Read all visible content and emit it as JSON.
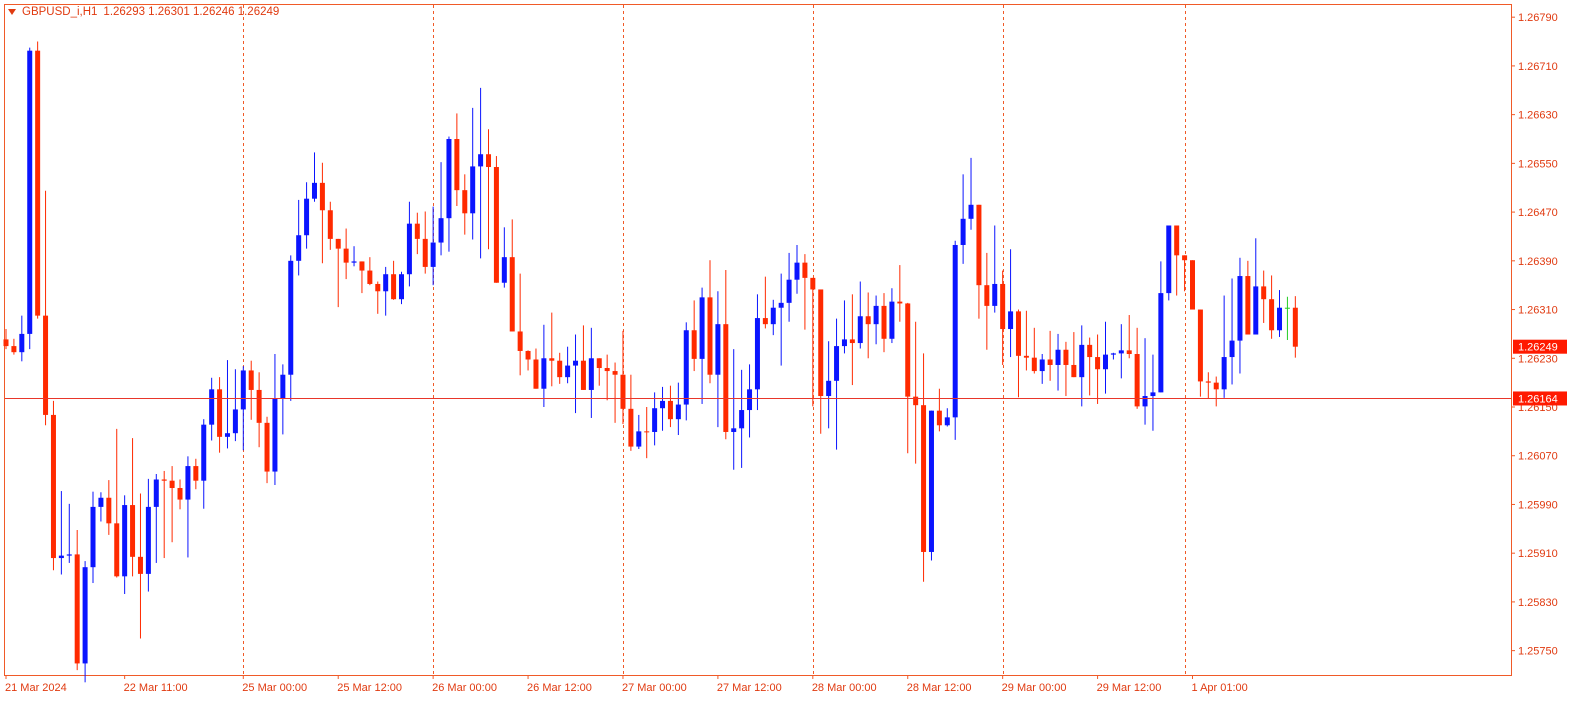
{
  "header": {
    "symbol": "GBPUSD_i,H1",
    "ohlc": "1.26293 1.26301 1.26246 1.26249"
  },
  "colors": {
    "frame": "#f05a28",
    "bull": "#0a14ff",
    "bear": "#ff2a00",
    "doji": "#22cc22",
    "separator": "#f05a28",
    "price_line": "#e8362a",
    "price_tag_bg": "#ff1a00",
    "price_tag_text": "#ffffff",
    "axis_text": "#e03a10"
  },
  "chart_data": {
    "type": "candlestick",
    "ylim": [
      1.2571,
      1.2681
    ],
    "y_ticks": [
      "1.26790",
      "1.26710",
      "1.26630",
      "1.26550",
      "1.26470",
      "1.26390",
      "1.26310",
      "1.26230",
      "1.26150",
      "1.26070",
      "1.25990",
      "1.25910",
      "1.25830",
      "1.25750"
    ],
    "x_labels": [
      "21 Mar 2024",
      "22 Mar 11:00",
      "25 Mar 00:00",
      "25 Mar 12:00",
      "26 Mar 00:00",
      "26 Mar 12:00",
      "27 Mar 00:00",
      "27 Mar 12:00",
      "28 Mar 00:00",
      "28 Mar 12:00",
      "29 Mar 00:00",
      "29 Mar 12:00",
      "1 Apr 01:00"
    ],
    "x_label_bar_index": [
      0,
      15,
      30,
      42,
      54,
      66,
      78,
      90,
      102,
      114,
      126,
      138,
      150
    ],
    "day_separator_bar_index": [
      30,
      54,
      78,
      102,
      126,
      149
    ],
    "last_price": "1.26249",
    "marked_price": "1.26164",
    "candles": [
      [
        1.26261,
        1.26278,
        1.26245,
        1.2625
      ],
      [
        1.2625,
        1.26262,
        1.26236,
        1.2624
      ],
      [
        1.2624,
        1.263,
        1.26225,
        1.2627
      ],
      [
        1.2627,
        1.2674,
        1.26245,
        1.26735
      ],
      [
        1.26735,
        1.2675,
        1.26295,
        1.263
      ],
      [
        1.263,
        1.26505,
        1.2612,
        1.26137
      ],
      [
        1.26137,
        1.2616,
        1.25882,
        1.25902
      ],
      [
        1.25902,
        1.26012,
        1.25875,
        1.25906
      ],
      [
        1.25906,
        1.25991,
        1.25894,
        1.25908
      ],
      [
        1.25908,
        1.25948,
        1.25718,
        1.25729
      ],
      [
        1.25729,
        1.25897,
        1.25698,
        1.25887
      ],
      [
        1.25887,
        1.26011,
        1.25861,
        1.25986
      ],
      [
        1.25986,
        1.2601,
        1.25962,
        1.26001
      ],
      [
        1.26001,
        1.2603,
        1.2594,
        1.25959
      ],
      [
        1.25959,
        1.26114,
        1.2587,
        1.25872
      ],
      [
        1.25872,
        1.26005,
        1.25843,
        1.25989
      ],
      [
        1.25989,
        1.26099,
        1.25872,
        1.25904
      ],
      [
        1.25904,
        1.26008,
        1.2577,
        1.25876
      ],
      [
        1.25876,
        1.26032,
        1.25847,
        1.25986
      ],
      [
        1.25986,
        1.2604,
        1.25894,
        1.26031
      ],
      [
        1.26031,
        1.26045,
        1.25902,
        1.26029
      ],
      [
        1.26029,
        1.26053,
        1.25928,
        1.26017
      ],
      [
        1.26017,
        1.26031,
        1.25982,
        1.25998
      ],
      [
        1.25998,
        1.26069,
        1.25903,
        1.26053
      ],
      [
        1.26053,
        1.26065,
        1.26015,
        1.26029
      ],
      [
        1.26029,
        1.2613,
        1.25983,
        1.26121
      ],
      [
        1.26121,
        1.26198,
        1.26095,
        1.26179
      ],
      [
        1.26179,
        1.26199,
        1.26075,
        1.26101
      ],
      [
        1.26101,
        1.26227,
        1.26082,
        1.26107
      ],
      [
        1.26107,
        1.26212,
        1.26094,
        1.26146
      ],
      [
        1.26146,
        1.26217,
        1.26079,
        1.2621
      ],
      [
        1.2621,
        1.26226,
        1.26129,
        1.26178
      ],
      [
        1.26178,
        1.26207,
        1.26084,
        1.26124
      ],
      [
        1.26124,
        1.26134,
        1.26025,
        1.26044
      ],
      [
        1.26044,
        1.26237,
        1.26022,
        1.26164
      ],
      [
        1.26164,
        1.2622,
        1.26105,
        1.26203
      ],
      [
        1.26203,
        1.26399,
        1.2616,
        1.2639
      ],
      [
        1.2639,
        1.2649,
        1.26366,
        1.26432
      ],
      [
        1.26432,
        1.26519,
        1.2641,
        1.26492
      ],
      [
        1.26492,
        1.26568,
        1.26487,
        1.26518
      ],
      [
        1.26518,
        1.26551,
        1.26386,
        1.26473
      ],
      [
        1.26473,
        1.26487,
        1.26408,
        1.26426
      ],
      [
        1.26426,
        1.26424,
        1.26314,
        1.2641
      ],
      [
        1.2641,
        1.26443,
        1.2636,
        1.26387
      ],
      [
        1.26387,
        1.26414,
        1.26381,
        1.26389
      ],
      [
        1.26389,
        1.26368,
        1.26337,
        1.26374
      ],
      [
        1.26374,
        1.26396,
        1.2635,
        1.26352
      ],
      [
        1.26352,
        1.26356,
        1.26303,
        1.2634
      ],
      [
        1.2634,
        1.2638,
        1.263,
        1.26368
      ],
      [
        1.26368,
        1.2639,
        1.26326,
        1.26327
      ],
      [
        1.26327,
        1.26372,
        1.26319,
        1.26368
      ],
      [
        1.26368,
        1.26487,
        1.26348,
        1.26451
      ],
      [
        1.26451,
        1.26469,
        1.26401,
        1.26426
      ],
      [
        1.26426,
        1.26471,
        1.26369,
        1.2638
      ],
      [
        1.2638,
        1.26479,
        1.2635,
        1.2642
      ],
      [
        1.2642,
        1.26552,
        1.26399,
        1.2646
      ],
      [
        1.2646,
        1.26594,
        1.26405,
        1.2659
      ],
      [
        1.2659,
        1.26632,
        1.2648,
        1.26506
      ],
      [
        1.26506,
        1.26532,
        1.26433,
        1.26468
      ],
      [
        1.26468,
        1.26641,
        1.26425,
        1.26545
      ],
      [
        1.26545,
        1.26674,
        1.26394,
        1.26565
      ],
      [
        1.26565,
        1.26606,
        1.26409,
        1.26544
      ],
      [
        1.26544,
        1.26562,
        1.26357,
        1.26354
      ],
      [
        1.26354,
        1.26445,
        1.26346,
        1.26396
      ],
      [
        1.26396,
        1.26458,
        1.26308,
        1.26274
      ],
      [
        1.26274,
        1.26369,
        1.26202,
        1.26242
      ],
      [
        1.26242,
        1.26243,
        1.2621,
        1.26228
      ],
      [
        1.26228,
        1.26246,
        1.2618,
        1.2618
      ],
      [
        1.2618,
        1.26285,
        1.2615,
        1.2623
      ],
      [
        1.2623,
        1.26305,
        1.26184,
        1.26226
      ],
      [
        1.26226,
        1.26239,
        1.26188,
        1.26199
      ],
      [
        1.26199,
        1.26249,
        1.26189,
        1.26218
      ],
      [
        1.26218,
        1.26269,
        1.2614,
        1.26226
      ],
      [
        1.26226,
        1.26284,
        1.26196,
        1.26178
      ],
      [
        1.26178,
        1.2628,
        1.26132,
        1.2623
      ],
      [
        1.2623,
        1.2623,
        1.26185,
        1.26214
      ],
      [
        1.26214,
        1.26236,
        1.26161,
        1.26209
      ],
      [
        1.26209,
        1.26223,
        1.26124,
        1.26203
      ],
      [
        1.26203,
        1.26275,
        1.26122,
        1.26147
      ],
      [
        1.26147,
        1.26203,
        1.26078,
        1.26085
      ],
      [
        1.26085,
        1.26137,
        1.26081,
        1.2611
      ],
      [
        1.2611,
        1.2615,
        1.26066,
        1.26109
      ],
      [
        1.26109,
        1.26174,
        1.26087,
        1.26148
      ],
      [
        1.26148,
        1.26183,
        1.26111,
        1.2616
      ],
      [
        1.2616,
        1.26185,
        1.26117,
        1.2613
      ],
      [
        1.2613,
        1.2619,
        1.26104,
        1.26154
      ],
      [
        1.26154,
        1.26289,
        1.26128,
        1.26276
      ],
      [
        1.26276,
        1.26325,
        1.26209,
        1.26229
      ],
      [
        1.26229,
        1.26346,
        1.26155,
        1.2633
      ],
      [
        1.2633,
        1.26391,
        1.26189,
        1.26203
      ],
      [
        1.26203,
        1.2634,
        1.26117,
        1.26286
      ],
      [
        1.26286,
        1.26375,
        1.26097,
        1.26109
      ],
      [
        1.26109,
        1.26245,
        1.26047,
        1.26115
      ],
      [
        1.26115,
        1.26211,
        1.2605,
        1.26145
      ],
      [
        1.26145,
        1.2622,
        1.261,
        1.26179
      ],
      [
        1.26179,
        1.26335,
        1.26145,
        1.26296
      ],
      [
        1.26296,
        1.26364,
        1.26279,
        1.26286
      ],
      [
        1.26286,
        1.26326,
        1.26268,
        1.26313
      ],
      [
        1.26313,
        1.26369,
        1.26218,
        1.26321
      ],
      [
        1.26321,
        1.26403,
        1.2629,
        1.26359
      ],
      [
        1.26359,
        1.26416,
        1.26336,
        1.26387
      ],
      [
        1.26387,
        1.26401,
        1.26277,
        1.26362
      ],
      [
        1.26362,
        1.26302,
        1.26151,
        1.26343
      ],
      [
        1.26343,
        1.26271,
        1.26106,
        1.26168
      ],
      [
        1.26168,
        1.26258,
        1.26115,
        1.26193
      ],
      [
        1.26193,
        1.26295,
        1.2608,
        1.2625
      ],
      [
        1.2625,
        1.26325,
        1.26238,
        1.26261
      ],
      [
        1.26261,
        1.26335,
        1.26186,
        1.26255
      ],
      [
        1.26255,
        1.26356,
        1.26246,
        1.26299
      ],
      [
        1.26299,
        1.26338,
        1.2623,
        1.26286
      ],
      [
        1.26286,
        1.26333,
        1.26253,
        1.26316
      ],
      [
        1.26316,
        1.26337,
        1.2624,
        1.26262
      ],
      [
        1.26262,
        1.26345,
        1.26255,
        1.26323
      ],
      [
        1.26323,
        1.26383,
        1.2629,
        1.2632
      ],
      [
        1.2632,
        1.26321,
        1.26074,
        1.26167
      ],
      [
        1.26167,
        1.2629,
        1.26057,
        1.26153
      ],
      [
        1.26153,
        1.26238,
        1.25863,
        1.25912
      ],
      [
        1.25912,
        1.26139,
        1.25898,
        1.26144
      ],
      [
        1.26144,
        1.2618,
        1.2611,
        1.2612
      ],
      [
        1.2612,
        1.26148,
        1.26118,
        1.26133
      ],
      [
        1.26133,
        1.26423,
        1.26096,
        1.26416
      ],
      [
        1.26416,
        1.26532,
        1.26385,
        1.26459
      ],
      [
        1.26459,
        1.26559,
        1.26441,
        1.26482
      ],
      [
        1.26482,
        1.26399,
        1.26295,
        1.2635
      ],
      [
        1.2635,
        1.26403,
        1.26244,
        1.26316
      ],
      [
        1.26316,
        1.26448,
        1.26305,
        1.26352
      ],
      [
        1.26352,
        1.26374,
        1.26219,
        1.26278
      ],
      [
        1.26278,
        1.26409,
        1.26232,
        1.26307
      ],
      [
        1.26307,
        1.2631,
        1.26166,
        1.26234
      ],
      [
        1.26234,
        1.26308,
        1.2621,
        1.26231
      ],
      [
        1.26231,
        1.2628,
        1.26205,
        1.26209
      ],
      [
        1.26209,
        1.26237,
        1.26188,
        1.26228
      ],
      [
        1.26228,
        1.26275,
        1.26193,
        1.26219
      ],
      [
        1.26219,
        1.2627,
        1.26177,
        1.26244
      ],
      [
        1.26244,
        1.26257,
        1.26168,
        1.26219
      ],
      [
        1.26219,
        1.26273,
        1.262,
        1.26199
      ],
      [
        1.26199,
        1.26284,
        1.26151,
        1.26252
      ],
      [
        1.26252,
        1.26264,
        1.26169,
        1.26232
      ],
      [
        1.26232,
        1.26269,
        1.26155,
        1.26212
      ],
      [
        1.26212,
        1.2629,
        1.26172,
        1.26236
      ],
      [
        1.26236,
        1.26239,
        1.26228,
        1.26238
      ],
      [
        1.26238,
        1.26286,
        1.26197,
        1.26243
      ],
      [
        1.26243,
        1.26301,
        1.2623,
        1.26237
      ],
      [
        1.26237,
        1.2628,
        1.26147,
        1.26151
      ],
      [
        1.26151,
        1.26263,
        1.26121,
        1.26168
      ],
      [
        1.26168,
        1.26236,
        1.26111,
        1.26174
      ],
      [
        1.26174,
        1.26389,
        1.26174,
        1.26337
      ],
      [
        1.26337,
        1.26433,
        1.26325,
        1.26448
      ],
      [
        1.26448,
        1.26383,
        1.26333,
        1.26399
      ],
      [
        1.26399,
        1.26387,
        1.2634,
        1.26391
      ],
      [
        1.26391,
        1.26302,
        1.26312,
        1.2631
      ],
      [
        1.2631,
        1.26256,
        1.26167,
        1.26192
      ],
      [
        1.26192,
        1.26207,
        1.26164,
        1.2619
      ],
      [
        1.2619,
        1.262,
        1.26151,
        1.26179
      ],
      [
        1.26179,
        1.26333,
        1.26165,
        1.26232
      ],
      [
        1.26232,
        1.26361,
        1.26187,
        1.26259
      ],
      [
        1.26259,
        1.26395,
        1.26205,
        1.26365
      ],
      [
        1.26365,
        1.2639,
        1.26279,
        1.26269
      ],
      [
        1.26269,
        1.26427,
        1.26271,
        1.26348
      ],
      [
        1.26348,
        1.26374,
        1.26288,
        1.26327
      ],
      [
        1.26327,
        1.26366,
        1.26262,
        1.26276
      ],
      [
        1.26276,
        1.26342,
        1.26265,
        1.26313
      ],
      [
        1.26313,
        1.26331,
        1.2626,
        1.26313
      ],
      [
        1.26313,
        1.26332,
        1.26231,
        1.26249
      ]
    ]
  }
}
